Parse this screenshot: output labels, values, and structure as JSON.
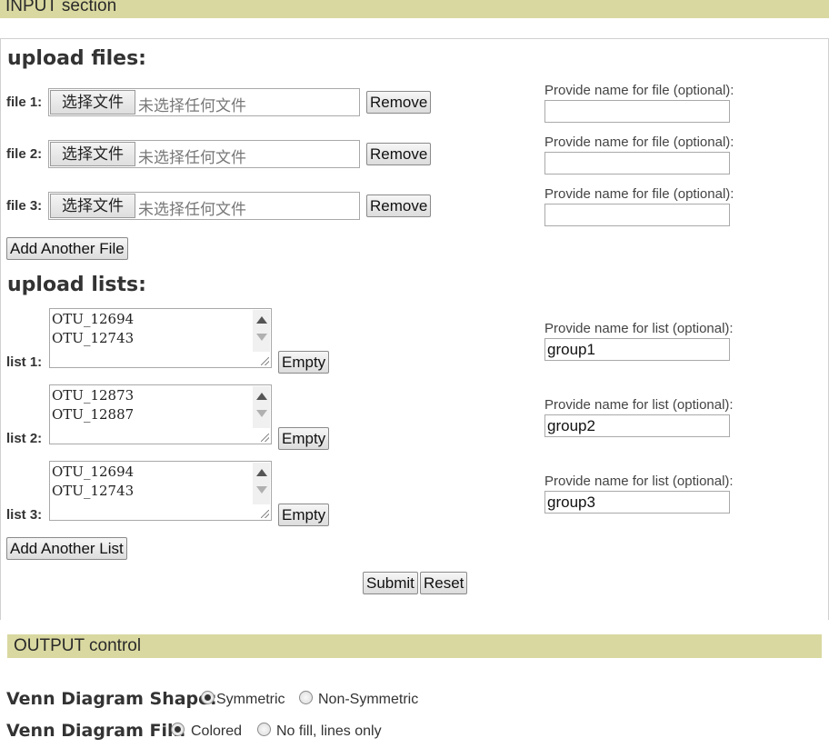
{
  "input_section": {
    "title": "INPUT section",
    "upload_files_heading": "upload files:",
    "files": [
      {
        "label": "file 1:",
        "choose_button": "选择文件",
        "status": "未选择任何文件",
        "remove_button": "Remove",
        "name_label": "Provide name for file (optional):",
        "name_value": ""
      },
      {
        "label": "file 2:",
        "choose_button": "选择文件",
        "status": "未选择任何文件",
        "remove_button": "Remove",
        "name_label": "Provide name for file (optional):",
        "name_value": ""
      },
      {
        "label": "file 3:",
        "choose_button": "选择文件",
        "status": "未选择任何文件",
        "remove_button": "Remove",
        "name_label": "Provide name for file (optional):",
        "name_value": ""
      }
    ],
    "add_file_button": "Add Another File",
    "upload_lists_heading": "upload lists:",
    "lists": [
      {
        "label": "list 1:",
        "lines": [
          "OTU_12694",
          "OTU_12743"
        ],
        "empty_button": "Empty",
        "name_label": "Provide name for list (optional):",
        "name_value": "group1"
      },
      {
        "label": "list 2:",
        "lines": [
          "OTU_12873",
          "OTU_12887"
        ],
        "empty_button": "Empty",
        "name_label": "Provide name for list (optional):",
        "name_value": "group2"
      },
      {
        "label": "list 3:",
        "lines": [
          "OTU_12694",
          "OTU_12743"
        ],
        "empty_button": "Empty",
        "name_label": "Provide name for list (optional):",
        "name_value": "group3"
      }
    ],
    "add_list_button": "Add Another List",
    "submit_button": "Submit",
    "reset_button": "Reset"
  },
  "output_control": {
    "title": "OUTPUT control",
    "shape": {
      "label": "Venn Diagram Shape:",
      "options": [
        "Symmetric",
        "Non-Symmetric"
      ],
      "selected": "Symmetric"
    },
    "fill": {
      "label": "Venn Diagram Fill:",
      "options": [
        "Colored",
        "No fill, lines only"
      ],
      "selected": "Colored"
    }
  },
  "colors": {
    "section_bar": "#d9d8a0"
  }
}
